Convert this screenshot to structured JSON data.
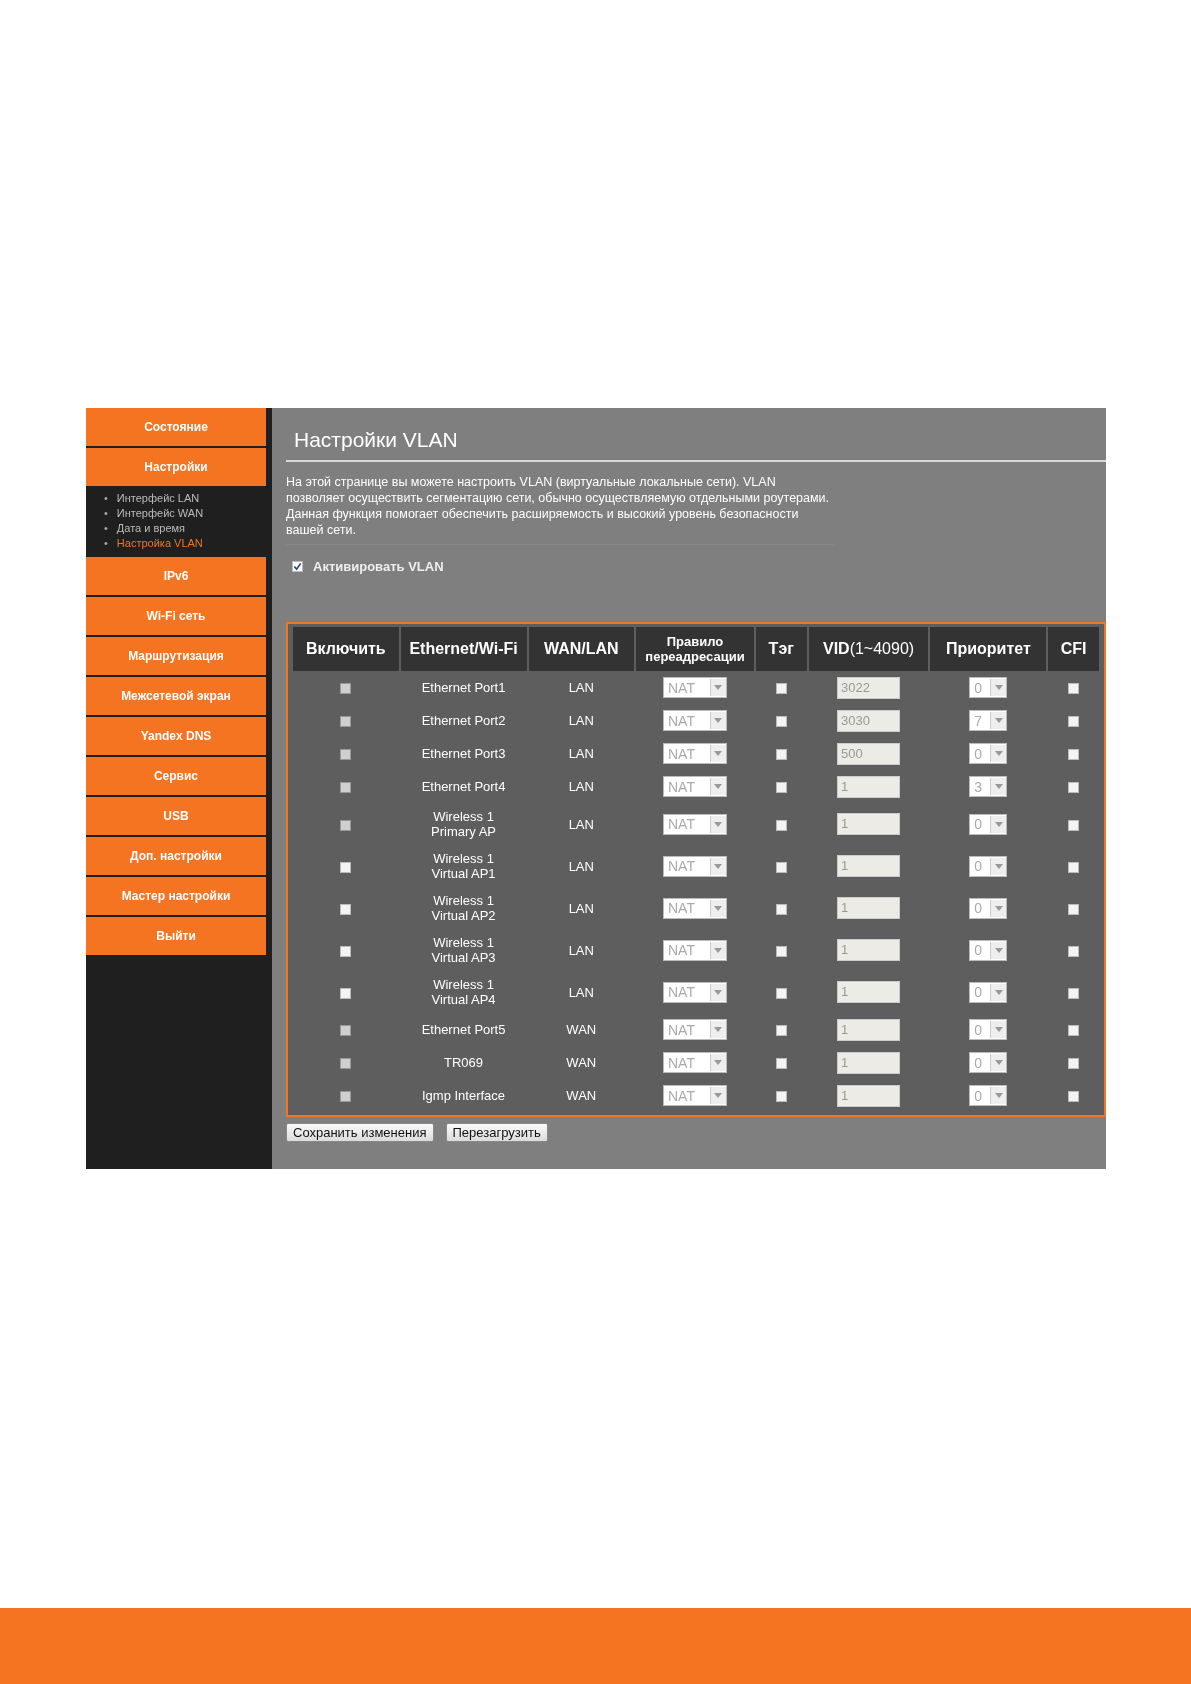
{
  "sidebar": {
    "items": [
      {
        "label": "Состояние"
      },
      {
        "label": "Настройки",
        "children": [
          {
            "bullet": "•",
            "label": "Интерфейс LAN",
            "selected": false
          },
          {
            "bullet": "•",
            "label": "Интерфейс WAN",
            "selected": false
          },
          {
            "bullet": "•",
            "label": "Дата и время",
            "selected": false
          },
          {
            "bullet": "•",
            "label": "Настройка VLAN",
            "selected": true
          }
        ]
      },
      {
        "label": "IPv6"
      },
      {
        "label": "Wi-Fi сеть"
      },
      {
        "label": "Маршрутизация"
      },
      {
        "label": "Межсетевой экран"
      },
      {
        "label": "Yandex DNS"
      },
      {
        "label": "Сервис"
      },
      {
        "label": "USB"
      },
      {
        "label": "Доп. настройки"
      },
      {
        "label": "Мастер настройки"
      },
      {
        "label": "Выйти"
      }
    ]
  },
  "page": {
    "title": "Настройки VLAN",
    "description": "На этой странице вы можете настроить VLAN (виртуальные локальные сети). VLAN позволяет осуществить сегментацию сети, обычно осуществляемую отдельными роутерами. Данная функция помогает обеспечить расширяемость и высокий уровень безопасности вашей сети.",
    "activate": {
      "label": "Активировать VLAN",
      "checked": true
    }
  },
  "table": {
    "columns": [
      "Включить",
      "Ethernet/Wi-Fi",
      "WAN/LAN",
      "Правило переадресации",
      "Тэг",
      "**VID**(1~4090)",
      "Приоритет",
      "CFI"
    ],
    "rows": [
      {
        "enabled": false,
        "enable_disabled": true,
        "name": "Ethernet Port1",
        "type": "LAN",
        "rule": "NAT",
        "tag": false,
        "vid": "3022",
        "priority": "0",
        "cfi": false
      },
      {
        "enabled": false,
        "enable_disabled": true,
        "name": "Ethernet Port2",
        "type": "LAN",
        "rule": "NAT",
        "tag": false,
        "vid": "3030",
        "priority": "7",
        "cfi": false
      },
      {
        "enabled": false,
        "enable_disabled": true,
        "name": "Ethernet Port3",
        "type": "LAN",
        "rule": "NAT",
        "tag": false,
        "vid": "500",
        "priority": "0",
        "cfi": false
      },
      {
        "enabled": false,
        "enable_disabled": true,
        "name": "Ethernet Port4",
        "type": "LAN",
        "rule": "NAT",
        "tag": false,
        "vid": "1",
        "priority": "3",
        "cfi": false
      },
      {
        "enabled": false,
        "enable_disabled": true,
        "name": "Wireless 1\nPrimary AP",
        "type": "LAN",
        "rule": "NAT",
        "tag": false,
        "vid": "1",
        "priority": "0",
        "cfi": false
      },
      {
        "enabled": false,
        "enable_disabled": false,
        "name": "Wireless 1\nVirtual AP1",
        "type": "LAN",
        "rule": "NAT",
        "tag": false,
        "vid": "1",
        "priority": "0",
        "cfi": false
      },
      {
        "enabled": false,
        "enable_disabled": false,
        "name": "Wireless 1\nVirtual AP2",
        "type": "LAN",
        "rule": "NAT",
        "tag": false,
        "vid": "1",
        "priority": "0",
        "cfi": false
      },
      {
        "enabled": false,
        "enable_disabled": false,
        "name": "Wireless 1\nVirtual AP3",
        "type": "LAN",
        "rule": "NAT",
        "tag": false,
        "vid": "1",
        "priority": "0",
        "cfi": false
      },
      {
        "enabled": false,
        "enable_disabled": false,
        "name": "Wireless 1\nVirtual AP4",
        "type": "LAN",
        "rule": "NAT",
        "tag": false,
        "vid": "1",
        "priority": "0",
        "cfi": false
      },
      {
        "enabled": false,
        "enable_disabled": true,
        "name": "Ethernet Port5",
        "type": "WAN",
        "rule": "NAT",
        "tag": false,
        "vid": "1",
        "priority": "0",
        "cfi": false
      },
      {
        "enabled": false,
        "enable_disabled": true,
        "name": "TR069",
        "type": "WAN",
        "rule": "NAT",
        "tag": false,
        "vid": "1",
        "priority": "0",
        "cfi": false
      },
      {
        "enabled": false,
        "enable_disabled": true,
        "name": "Igmp Interface",
        "type": "WAN",
        "rule": "NAT",
        "tag": false,
        "vid": "1",
        "priority": "0",
        "cfi": false
      }
    ]
  },
  "buttons": [
    "Сохранить изменения",
    "Перезагрузить"
  ]
}
